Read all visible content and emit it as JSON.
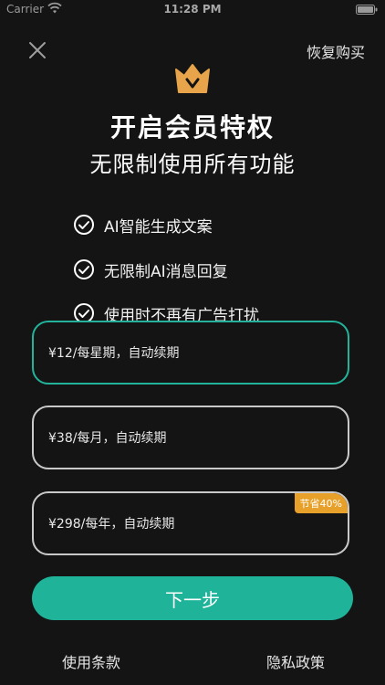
{
  "status_bar": {
    "carrier": "Carrier",
    "time": "11:28 PM"
  },
  "header": {
    "restore_label": "恢复购买"
  },
  "hero": {
    "title": "开启会员特权",
    "subtitle": "无限制使用所有功能"
  },
  "features": [
    {
      "label": "AI智能生成文案",
      "icon": "check-circle-icon"
    },
    {
      "label": "无限制AI消息回复",
      "icon": "check-circle-icon"
    },
    {
      "label": "使用时不再有广告打扰",
      "icon": "check-circle-icon"
    }
  ],
  "plans": [
    {
      "label": "¥12/每星期，自动续期",
      "selected": true
    },
    {
      "label": "¥38/每月，自动续期",
      "selected": false
    },
    {
      "label": "¥298/每年，自动续期",
      "selected": false,
      "badge": "节省40%"
    }
  ],
  "cta": {
    "next_label": "下一步"
  },
  "footer": {
    "terms_label": "使用条款",
    "privacy_label": "隐私政策"
  },
  "colors": {
    "background": "#141414",
    "accent": "#1fb39a",
    "badge": "#e7a12a",
    "crown": "#e8a44a"
  }
}
